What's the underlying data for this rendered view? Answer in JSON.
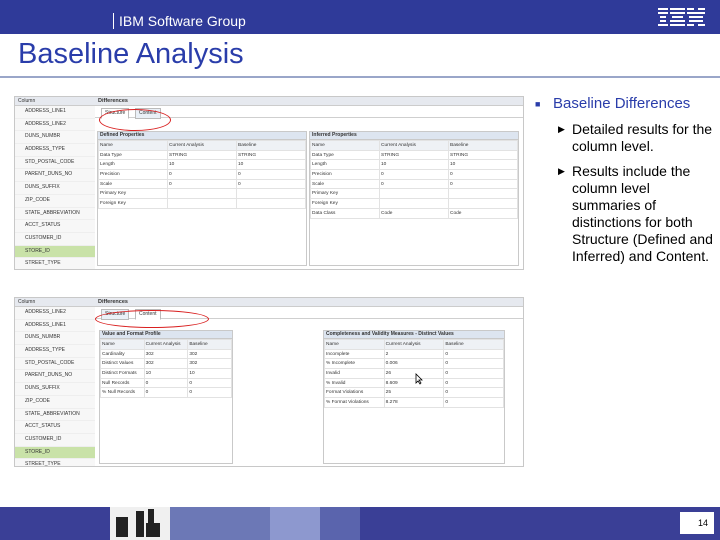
{
  "header": {
    "group": "IBM Software Group",
    "logo": "IBM"
  },
  "slide": {
    "title": "Baseline Analysis",
    "page_number": "14"
  },
  "bullets": {
    "main": "Baseline Differences",
    "subs": [
      "Detailed results for the column level.",
      "Results include the column level summaries of distinctions for both Structure (Defined and Inferred) and Content."
    ]
  },
  "shot1": {
    "tree_header": "Column",
    "tree_items": [
      "ADDRESS_LINE1",
      "ADDRESS_LINE2",
      "DUNS_NUMBR",
      "ADDRESS_TYPE",
      "STD_POSTAL_CODE",
      "PARENT_DUNS_NO",
      "DUNS_SUFFIX",
      "ZIP_CODE",
      "STATE_ABBREVIATION",
      "ACCT_STATUS",
      "CUSTOMER_ID",
      "STORE_ID",
      "STREET_TYPE"
    ],
    "selected_index": 11,
    "panel_title": "Differences",
    "tabs": [
      "Structure",
      "Content"
    ],
    "defined": {
      "title": "Defined Properties",
      "columns": [
        "Name",
        "Current Analysis",
        "Baseline"
      ],
      "rows": [
        [
          "Data Type",
          "STRING",
          "STRING"
        ],
        [
          "Length",
          "10",
          "10"
        ],
        [
          "Precision",
          "0",
          "0"
        ],
        [
          "Scale",
          "0",
          "0"
        ],
        [
          "Primary Key",
          "",
          ""
        ],
        [
          "Foreign Key",
          "",
          ""
        ]
      ]
    },
    "inferred": {
      "title": "Inferred Properties",
      "columns": [
        "Name",
        "Current Analysis",
        "Baseline"
      ],
      "rows": [
        [
          "Data Type",
          "STRING",
          "STRING"
        ],
        [
          "Length",
          "10",
          "10"
        ],
        [
          "Precision",
          "0",
          "0"
        ],
        [
          "Scale",
          "0",
          "0"
        ],
        [
          "Primary Key",
          "",
          ""
        ],
        [
          "Foreign Key",
          "",
          ""
        ],
        [
          "Data Class",
          "Code",
          "Code"
        ]
      ]
    }
  },
  "shot2": {
    "tree_header": "Column",
    "tree_items": [
      "ADDRESS_LINE2",
      "ADDRESS_LINE1",
      "DUNS_NUMBR",
      "ADDRESS_TYPE",
      "STD_POSTAL_CODE",
      "PARENT_DUNS_NO",
      "DUNS_SUFFIX",
      "ZIP_CODE",
      "STATE_ABBREVIATION",
      "ACCT_STATUS",
      "CUSTOMER_ID",
      "STORE_ID",
      "STREET_TYPE"
    ],
    "selected_index": 11,
    "panel_title": "Differences",
    "tabs": [
      "Structure",
      "Content"
    ],
    "value_format": {
      "title": "Value and Format Profile",
      "columns": [
        "Name",
        "Current Analysis",
        "Baseline"
      ],
      "rows": [
        [
          "Cardinality",
          "302",
          "302"
        ],
        [
          "Distinct Values",
          "302",
          "302"
        ],
        [
          "Distinct Formats",
          "10",
          "10"
        ],
        [
          "Null Records",
          "0",
          "0"
        ],
        [
          "% Null Records",
          "0",
          "0"
        ]
      ]
    },
    "completeness": {
      "title": "Completeness and Validity Measures - Distinct Values",
      "columns": [
        "Name",
        "Current Analysis",
        "Baseline"
      ],
      "rows": [
        [
          "Incomplete",
          "2",
          "0"
        ],
        [
          "% Incomplete",
          "0.006",
          "0"
        ],
        [
          "Invalid",
          "26",
          "0"
        ],
        [
          "% Invalid",
          "8.609",
          "0"
        ],
        [
          "Format Violations",
          "25",
          "0"
        ],
        [
          "% Format Violations",
          "8.278",
          "0"
        ]
      ]
    }
  }
}
